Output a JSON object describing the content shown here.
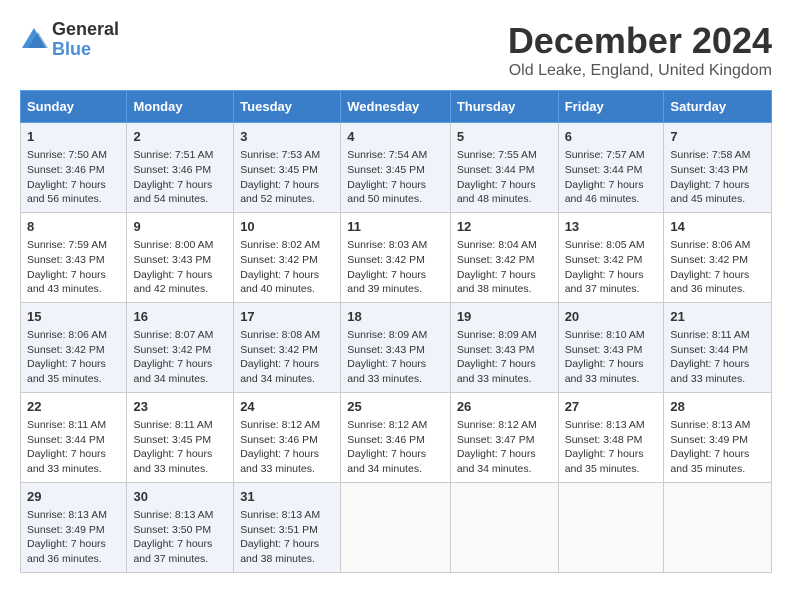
{
  "logo": {
    "general": "General",
    "blue": "Blue"
  },
  "title": "December 2024",
  "subtitle": "Old Leake, England, United Kingdom",
  "days_of_week": [
    "Sunday",
    "Monday",
    "Tuesday",
    "Wednesday",
    "Thursday",
    "Friday",
    "Saturday"
  ],
  "weeks": [
    [
      {
        "day": 1,
        "sunrise": "7:50 AM",
        "sunset": "3:46 PM",
        "daylight": "7 hours and 56 minutes."
      },
      {
        "day": 2,
        "sunrise": "7:51 AM",
        "sunset": "3:46 PM",
        "daylight": "7 hours and 54 minutes."
      },
      {
        "day": 3,
        "sunrise": "7:53 AM",
        "sunset": "3:45 PM",
        "daylight": "7 hours and 52 minutes."
      },
      {
        "day": 4,
        "sunrise": "7:54 AM",
        "sunset": "3:45 PM",
        "daylight": "7 hours and 50 minutes."
      },
      {
        "day": 5,
        "sunrise": "7:55 AM",
        "sunset": "3:44 PM",
        "daylight": "7 hours and 48 minutes."
      },
      {
        "day": 6,
        "sunrise": "7:57 AM",
        "sunset": "3:44 PM",
        "daylight": "7 hours and 46 minutes."
      },
      {
        "day": 7,
        "sunrise": "7:58 AM",
        "sunset": "3:43 PM",
        "daylight": "7 hours and 45 minutes."
      }
    ],
    [
      {
        "day": 8,
        "sunrise": "7:59 AM",
        "sunset": "3:43 PM",
        "daylight": "7 hours and 43 minutes."
      },
      {
        "day": 9,
        "sunrise": "8:00 AM",
        "sunset": "3:43 PM",
        "daylight": "7 hours and 42 minutes."
      },
      {
        "day": 10,
        "sunrise": "8:02 AM",
        "sunset": "3:42 PM",
        "daylight": "7 hours and 40 minutes."
      },
      {
        "day": 11,
        "sunrise": "8:03 AM",
        "sunset": "3:42 PM",
        "daylight": "7 hours and 39 minutes."
      },
      {
        "day": 12,
        "sunrise": "8:04 AM",
        "sunset": "3:42 PM",
        "daylight": "7 hours and 38 minutes."
      },
      {
        "day": 13,
        "sunrise": "8:05 AM",
        "sunset": "3:42 PM",
        "daylight": "7 hours and 37 minutes."
      },
      {
        "day": 14,
        "sunrise": "8:06 AM",
        "sunset": "3:42 PM",
        "daylight": "7 hours and 36 minutes."
      }
    ],
    [
      {
        "day": 15,
        "sunrise": "8:06 AM",
        "sunset": "3:42 PM",
        "daylight": "7 hours and 35 minutes."
      },
      {
        "day": 16,
        "sunrise": "8:07 AM",
        "sunset": "3:42 PM",
        "daylight": "7 hours and 34 minutes."
      },
      {
        "day": 17,
        "sunrise": "8:08 AM",
        "sunset": "3:42 PM",
        "daylight": "7 hours and 34 minutes."
      },
      {
        "day": 18,
        "sunrise": "8:09 AM",
        "sunset": "3:43 PM",
        "daylight": "7 hours and 33 minutes."
      },
      {
        "day": 19,
        "sunrise": "8:09 AM",
        "sunset": "3:43 PM",
        "daylight": "7 hours and 33 minutes."
      },
      {
        "day": 20,
        "sunrise": "8:10 AM",
        "sunset": "3:43 PM",
        "daylight": "7 hours and 33 minutes."
      },
      {
        "day": 21,
        "sunrise": "8:11 AM",
        "sunset": "3:44 PM",
        "daylight": "7 hours and 33 minutes."
      }
    ],
    [
      {
        "day": 22,
        "sunrise": "8:11 AM",
        "sunset": "3:44 PM",
        "daylight": "7 hours and 33 minutes."
      },
      {
        "day": 23,
        "sunrise": "8:11 AM",
        "sunset": "3:45 PM",
        "daylight": "7 hours and 33 minutes."
      },
      {
        "day": 24,
        "sunrise": "8:12 AM",
        "sunset": "3:46 PM",
        "daylight": "7 hours and 33 minutes."
      },
      {
        "day": 25,
        "sunrise": "8:12 AM",
        "sunset": "3:46 PM",
        "daylight": "7 hours and 34 minutes."
      },
      {
        "day": 26,
        "sunrise": "8:12 AM",
        "sunset": "3:47 PM",
        "daylight": "7 hours and 34 minutes."
      },
      {
        "day": 27,
        "sunrise": "8:13 AM",
        "sunset": "3:48 PM",
        "daylight": "7 hours and 35 minutes."
      },
      {
        "day": 28,
        "sunrise": "8:13 AM",
        "sunset": "3:49 PM",
        "daylight": "7 hours and 35 minutes."
      }
    ],
    [
      {
        "day": 29,
        "sunrise": "8:13 AM",
        "sunset": "3:49 PM",
        "daylight": "7 hours and 36 minutes."
      },
      {
        "day": 30,
        "sunrise": "8:13 AM",
        "sunset": "3:50 PM",
        "daylight": "7 hours and 37 minutes."
      },
      {
        "day": 31,
        "sunrise": "8:13 AM",
        "sunset": "3:51 PM",
        "daylight": "7 hours and 38 minutes."
      },
      null,
      null,
      null,
      null
    ]
  ]
}
